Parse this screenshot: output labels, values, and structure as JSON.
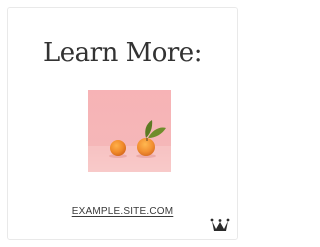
{
  "card": {
    "title": "Learn More:",
    "link_text": "EXAMPLE.SITE.COM",
    "image_alt": "two apricots on a pink background"
  },
  "colors": {
    "background": "#ffffff",
    "card_border": "#e9e9e9",
    "title_text": "#333333",
    "photo_pink": "#f6b6b8",
    "fruit_orange": "#ef8a2c",
    "leaf_green": "#6a8a2a"
  },
  "icons": {
    "badge": "crown-logo-icon"
  }
}
